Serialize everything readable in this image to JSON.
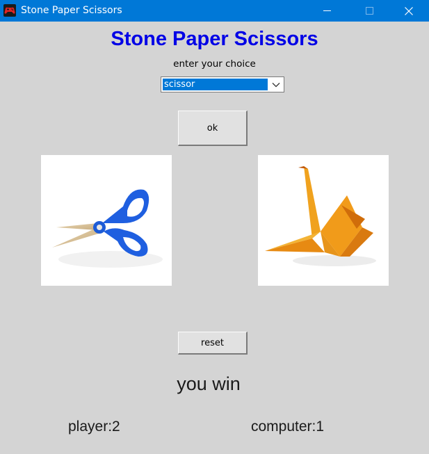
{
  "window": {
    "title": "Stone Paper Scissors",
    "titlebar_color": "#0078d7"
  },
  "app": {
    "heading": "Stone Paper Scissors",
    "heading_color": "#0000e6",
    "prompt": "enter your choice",
    "choice_selected": "scissor",
    "ok_label": "ok",
    "reset_label": "reset",
    "player_image": "scissors-image",
    "computer_image": "paper-crane-image",
    "result": "you win",
    "player_score": "player:2",
    "computer_score": "computer:1"
  }
}
